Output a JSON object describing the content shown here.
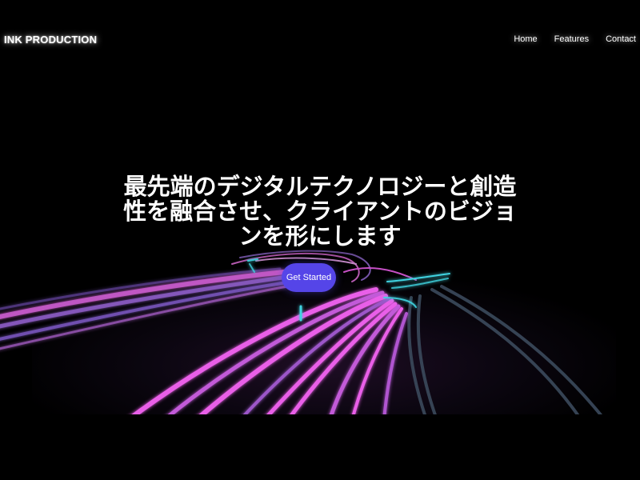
{
  "header": {
    "brand": "INK PRODUCTION",
    "nav": [
      {
        "label": "Home"
      },
      {
        "label": "Features"
      },
      {
        "label": "Contact"
      }
    ]
  },
  "hero": {
    "headline": "最先端のデジタルテクノロジーと創造性を融合させ、クライアントのビジョンを形にします",
    "cta_label": "Get Started"
  },
  "colors": {
    "background": "#000000",
    "accent": "#5545e8",
    "neon_pink": "#e95ee8",
    "neon_purple": "#8c5cc4",
    "neon_cyan": "#3fd3e0",
    "rail_gray": "#3b4a5c"
  },
  "icons": []
}
